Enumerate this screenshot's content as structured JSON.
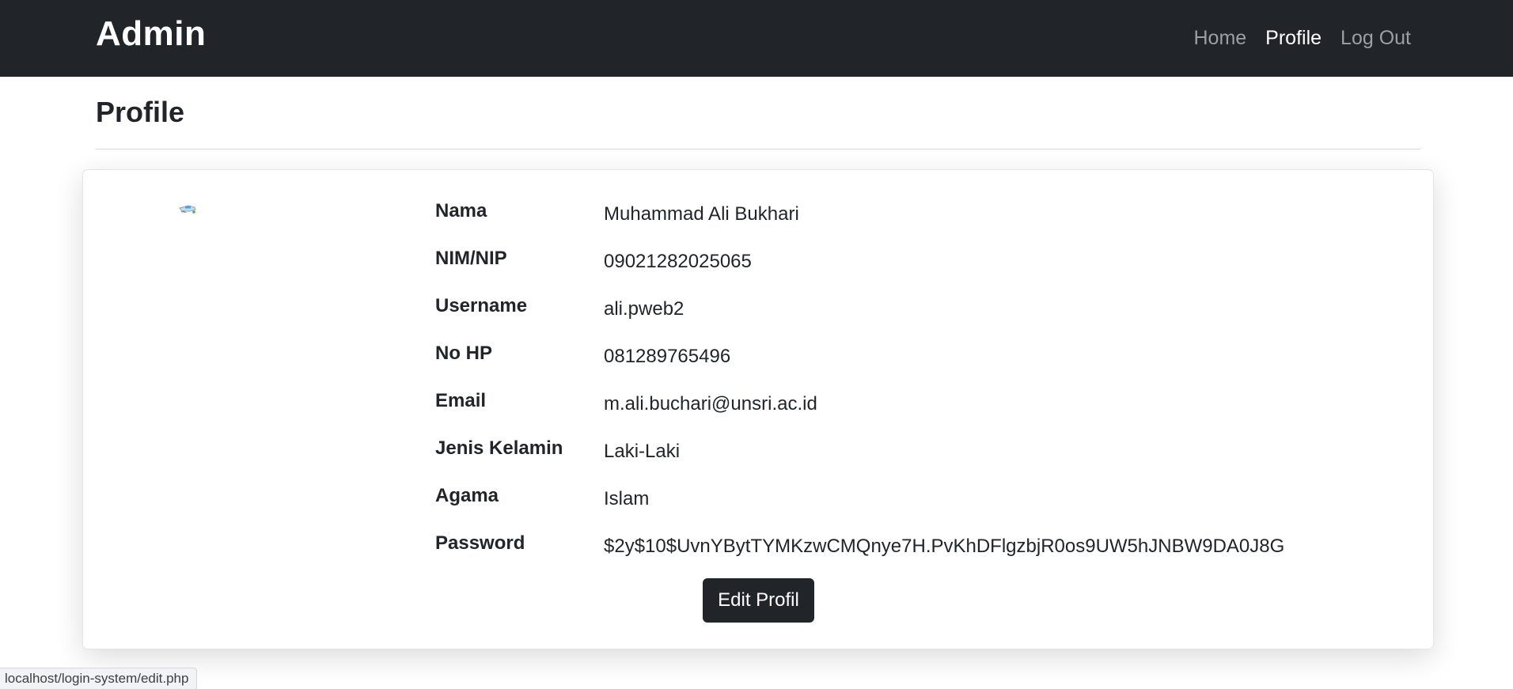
{
  "navbar": {
    "brand": "Admin",
    "links": [
      {
        "label": "Home"
      },
      {
        "label": "Profile"
      },
      {
        "label": "Log Out"
      }
    ]
  },
  "page": {
    "title": "Profile"
  },
  "profile": {
    "fields": [
      {
        "label": "Nama",
        "value": "Muhammad Ali Bukhari"
      },
      {
        "label": "NIM/NIP",
        "value": "09021282025065"
      },
      {
        "label": "Username",
        "value": "ali.pweb2"
      },
      {
        "label": "No HP",
        "value": "081289765496"
      },
      {
        "label": "Email",
        "value": "m.ali.buchari@unsri.ac.id"
      },
      {
        "label": "Jenis Kelamin",
        "value": "Laki-Laki"
      },
      {
        "label": "Agama",
        "value": "Islam"
      },
      {
        "label": "Password",
        "value": "$2y$10$UvnYBytTYMKzwCMQnye7H.PvKhDFlgzbjR0os9UW5hJNBW9DA0J8G"
      }
    ],
    "edit_button_label": "Edit Profil",
    "avatar_icon": "broken-image-icon"
  },
  "status_bar": {
    "url": "localhost/login-system/edit.php"
  },
  "colors": {
    "navbar_bg": "#212529",
    "nav_link": "#9aa0a6",
    "nav_link_active": "#ffffff",
    "button_bg": "#212529"
  }
}
